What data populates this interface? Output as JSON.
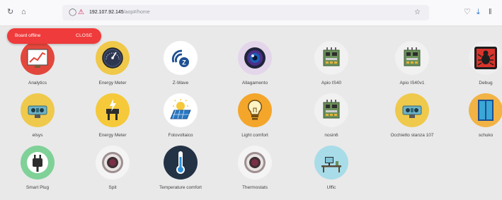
{
  "browser": {
    "url_host": "192.107.92.145",
    "url_path": "/aop#/home"
  },
  "toast": {
    "message": "Board offline",
    "close_label": "CLOSE"
  },
  "devices": [
    {
      "label": "Analytics",
      "icon": "analytics-chart-icon",
      "bg": "#e3473c"
    },
    {
      "label": "Energy Meter",
      "icon": "gauge-meter-icon",
      "bg": "#f0c84a"
    },
    {
      "label": "Z-Wave",
      "icon": "zwave-logo-icon",
      "bg": "#ffffff"
    },
    {
      "label": "Allagamento",
      "icon": "camera-lens-icon",
      "bg": "#e4d6ea"
    },
    {
      "label": "Apio IS40",
      "icon": "circuit-board-icon",
      "bg": "#f1f1f1"
    },
    {
      "label": "Apio IS40v1",
      "icon": "circuit-board-icon",
      "bg": "#f1f1f1"
    },
    {
      "label": "Debug",
      "icon": "bug-icon",
      "bg": "#eeeeee"
    },
    {
      "label": "elsys",
      "icon": "sensor-device-icon",
      "bg": "#efc94c"
    },
    {
      "label": "Energy Meter",
      "icon": "energy-plug-icon",
      "bg": "#f5c93a"
    },
    {
      "label": "Fotovoltaico",
      "icon": "solar-panel-icon",
      "bg": "#ffffff"
    },
    {
      "label": "Light comfort",
      "icon": "lightbulb-icon",
      "bg": "#f4a62b"
    },
    {
      "label": "nosin6",
      "icon": "circuit-board-icon",
      "bg": "#f1f1f1"
    },
    {
      "label": "Occhietto stanza 107",
      "icon": "sensor-device-icon",
      "bg": "#efc94c"
    },
    {
      "label": "schuko",
      "icon": "window-icon",
      "bg": "#f2b345"
    },
    {
      "label": "Smart Plug",
      "icon": "power-plug-icon",
      "bg": "#7fd198"
    },
    {
      "label": "Spit",
      "icon": "thermostat-dial-icon",
      "bg": "#f4f4f4"
    },
    {
      "label": "Temperature comfort",
      "icon": "thermometer-icon",
      "bg": "#233245"
    },
    {
      "label": "Thermostats",
      "icon": "thermostat-dial-icon",
      "bg": "#f4f4f4"
    },
    {
      "label": "Uffic",
      "icon": "office-desk-icon",
      "bg": "#a8dce8"
    }
  ]
}
